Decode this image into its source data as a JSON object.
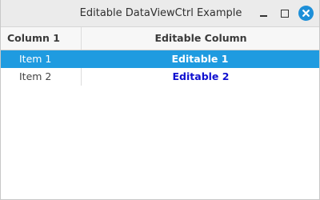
{
  "window": {
    "title": "Editable DataViewCtrl Example"
  },
  "table": {
    "columns": [
      "Column 1",
      "Editable Column"
    ],
    "rows": [
      {
        "col1": "Item 1",
        "col2": "Editable 1",
        "selected": true
      },
      {
        "col1": "Item 2",
        "col2": "Editable 2",
        "selected": false
      }
    ]
  },
  "icons": {
    "minimize": "minimize-icon",
    "maximize": "maximize-icon",
    "close": "close-icon"
  },
  "colors": {
    "selection": "#1f9be0",
    "editable_text": "#1010d0",
    "close_button": "#1d8fd8"
  }
}
